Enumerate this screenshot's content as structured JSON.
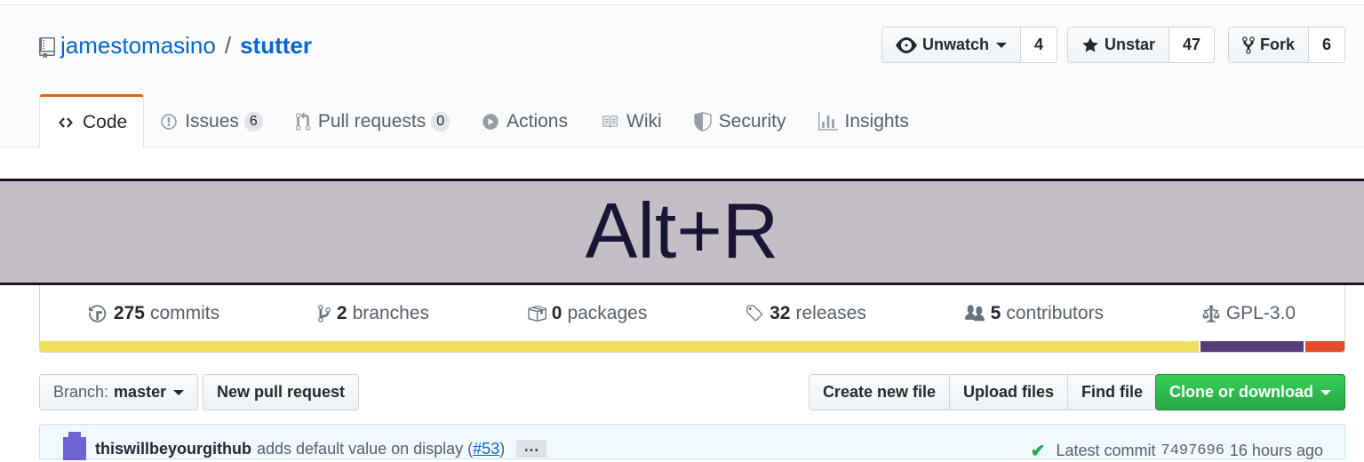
{
  "repo": {
    "owner": "jamestomasino",
    "separator": "/",
    "name": "stutter"
  },
  "actions": {
    "watch": {
      "label": "Unwatch",
      "count": "4"
    },
    "star": {
      "label": "Unstar",
      "count": "47"
    },
    "fork": {
      "label": "Fork",
      "count": "6"
    }
  },
  "tabs": [
    {
      "label": "Code",
      "icon": "code-icon"
    },
    {
      "label": "Issues",
      "count": "6",
      "icon": "issue-icon"
    },
    {
      "label": "Pull requests",
      "count": "0",
      "icon": "pull-request-icon"
    },
    {
      "label": "Actions",
      "icon": "play-icon"
    },
    {
      "label": "Wiki",
      "icon": "book-icon"
    },
    {
      "label": "Security",
      "icon": "shield-icon"
    },
    {
      "label": "Insights",
      "icon": "graph-icon"
    }
  ],
  "banner": {
    "text": "Alt+R"
  },
  "summary": {
    "commits": {
      "count": "275",
      "label": "commits"
    },
    "branches": {
      "count": "2",
      "label": "branches"
    },
    "packages": {
      "count": "0",
      "label": "packages"
    },
    "releases": {
      "count": "32",
      "label": "releases"
    },
    "contributors": {
      "count": "5",
      "label": "contributors"
    },
    "license": {
      "label": "GPL-3.0"
    }
  },
  "languages": [
    {
      "color": "#f1e05a",
      "share": 0.891
    },
    {
      "color": "#563d7c",
      "share": 0.079
    },
    {
      "color": "#e34c26",
      "share": 0.03
    }
  ],
  "toolbar": {
    "branch_prefix": "Branch:",
    "branch_name": "master",
    "new_pull_request": "New pull request",
    "create_new_file": "Create new file",
    "upload_files": "Upload files",
    "find_file": "Find file",
    "clone_or_download": "Clone or download"
  },
  "commit": {
    "author": "thiswillbeyourgithub",
    "message": "adds default value on display (",
    "pr_link": "#53",
    "message_end": ")",
    "ellipsis": "…",
    "latest_label": "Latest commit",
    "sha": "7497696",
    "time": "16 hours ago"
  }
}
